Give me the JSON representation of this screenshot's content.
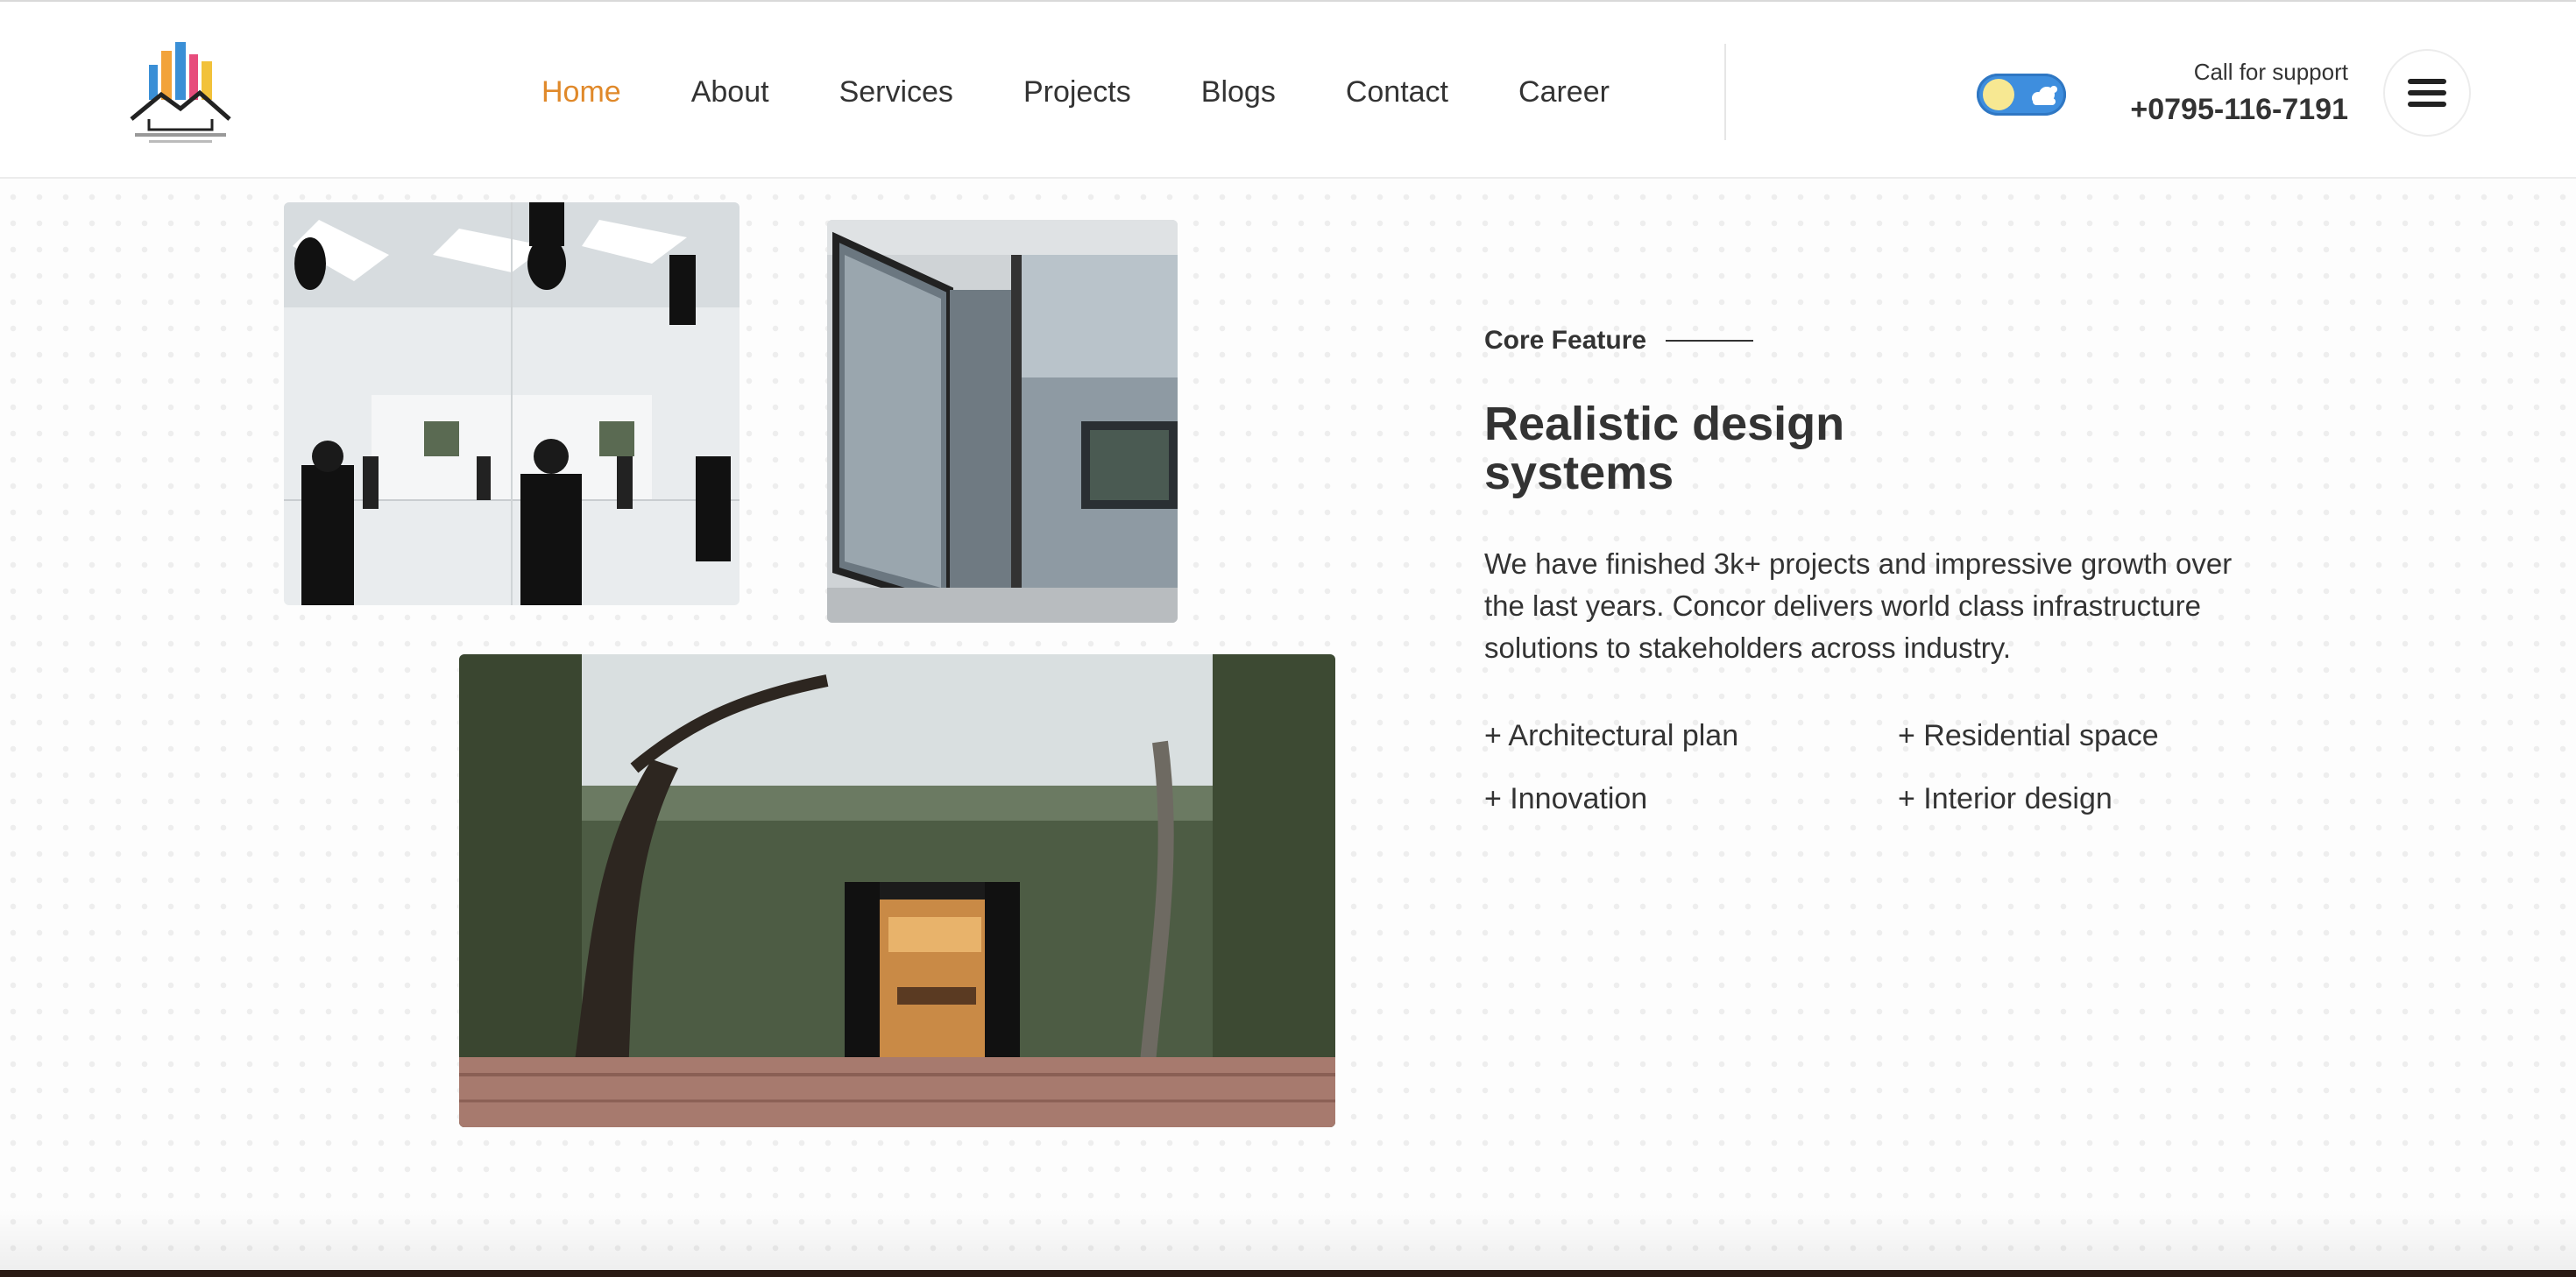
{
  "header": {
    "nav": [
      {
        "label": "Home",
        "active": true
      },
      {
        "label": "About"
      },
      {
        "label": "Services"
      },
      {
        "label": "Projects"
      },
      {
        "label": "Blogs"
      },
      {
        "label": "Contact"
      },
      {
        "label": "Career"
      }
    ],
    "support_label": "Call for support",
    "support_phone": "+0795-116-7191",
    "accent_color": "#e0892a"
  },
  "feature": {
    "eyebrow": "Core Feature",
    "heading": "Realistic design systems",
    "description": "We have finished 3k+ projects and impressive growth over the last years. Concor delivers world class infrastructure solutions to stakeholders across industry.",
    "items": [
      "+ Architectural plan",
      "+ Residential space",
      "+ Innovation",
      "+ Interior design"
    ]
  },
  "icons": {
    "theme_toggle": "sun-cloud-toggle-icon",
    "menu": "hamburger-icon"
  }
}
